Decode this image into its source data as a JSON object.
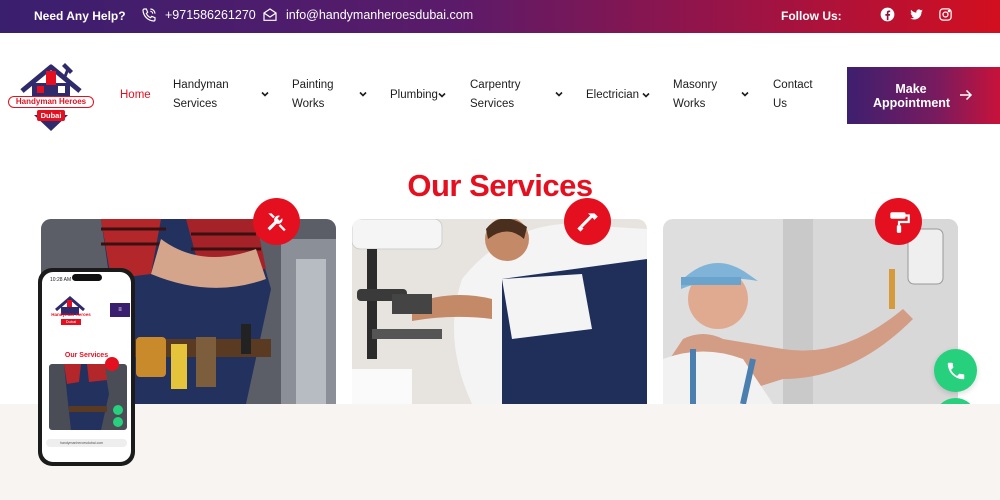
{
  "topbar": {
    "help_text": "Need Any Help?",
    "phone": "+971586261270",
    "email": "info@handymanheroesdubai.com",
    "follow_text": "Follow Us:",
    "social_icons": [
      "facebook-icon",
      "twitter-icon",
      "instagram-icon"
    ]
  },
  "logo": {
    "line1": "Handyman Heroes",
    "line2": "Dubai"
  },
  "nav": {
    "items": [
      {
        "label_1": "Home",
        "label_2": "",
        "has_dropdown": false,
        "active": true
      },
      {
        "label_1": "Handyman",
        "label_2": "Services",
        "has_dropdown": true
      },
      {
        "label_1": "Painting",
        "label_2": "Works",
        "has_dropdown": true
      },
      {
        "label_1": "Plumbing",
        "label_2": "",
        "has_dropdown": true
      },
      {
        "label_1": "Carpentry",
        "label_2": "Services",
        "has_dropdown": true
      },
      {
        "label_1": "Electrician",
        "label_2": "",
        "has_dropdown": true
      },
      {
        "label_1": "Masonry",
        "label_2": "Works",
        "has_dropdown": true
      },
      {
        "label_1": "Contact",
        "label_2": "Us",
        "has_dropdown": false
      }
    ],
    "cta_line1": "Make",
    "cta_line2": "Appointment"
  },
  "services": {
    "title": "Our Services",
    "cards": [
      {
        "icon": "tools-icon"
      },
      {
        "icon": "hammer-icon"
      },
      {
        "icon": "paint-roller-icon"
      }
    ]
  },
  "phone_mockup": {
    "time": "10:28 AM",
    "title": "Our Services",
    "logo_line1": "Handyman Heroes",
    "logo_line2": "Dubai",
    "menu_glyph": "≡",
    "url": "handymanheroesdubai.com"
  },
  "colors": {
    "brand_red": "#e5101f",
    "brand_purple": "#3a1f6e",
    "whatsapp_green": "#26d07c"
  }
}
